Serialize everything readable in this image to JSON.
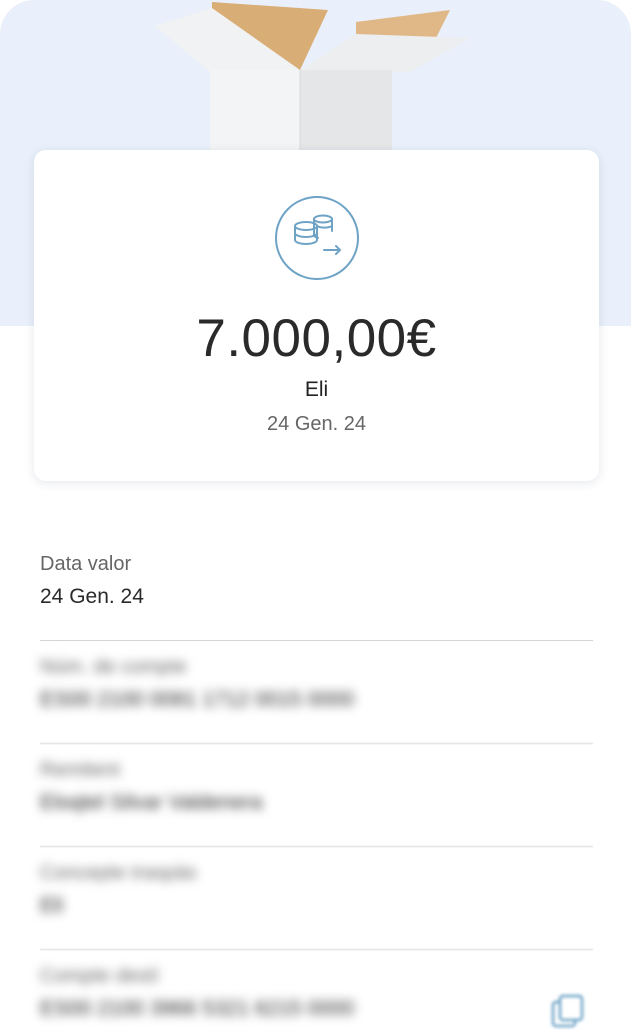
{
  "summary": {
    "amount": "7.000,00€",
    "beneficiary": "Eli",
    "date": "24 Gen. 24",
    "icon": "coins-transfer-icon",
    "accent": "#6ea3c6"
  },
  "details": [
    {
      "label": "Data valor",
      "value": "24 Gen. 24",
      "blurred": false
    },
    {
      "label": "Núm. de compte",
      "value": "ES00 2100 0081 1712 0015 0000",
      "blurred": true
    },
    {
      "label": "Remitent",
      "value": "Eloqtel Silvar Valdenera",
      "blurred": true
    },
    {
      "label": "Concepte traspàs",
      "value": "Eli",
      "blurred": true
    },
    {
      "label": "Compte destí",
      "value": "ES00 2100 3966 5321 6215 0000",
      "blurred": true
    }
  ],
  "copy_icon": "copy-icon"
}
